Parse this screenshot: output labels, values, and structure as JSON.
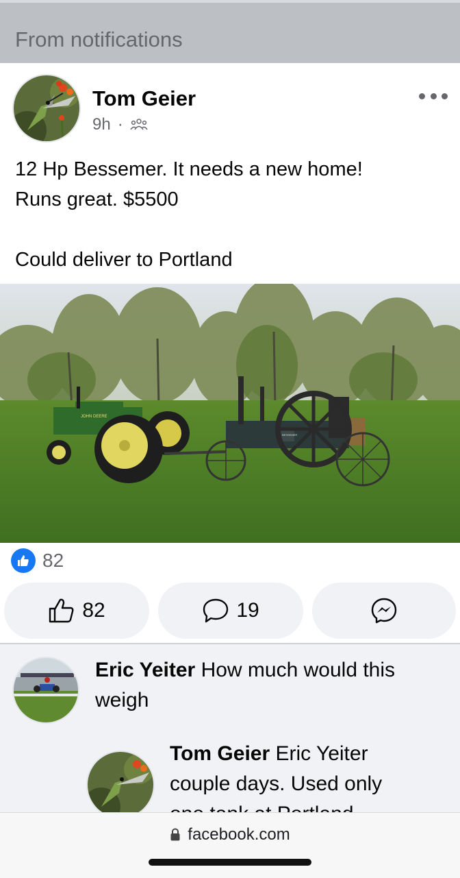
{
  "notification_bar": {
    "label": "From notifications"
  },
  "post": {
    "author": "Tom Geier",
    "time": "9h",
    "audience_icon": "friends-icon",
    "lines": [
      "12 Hp Bessemer.  It needs a new home!",
      "Runs great.  $5500",
      "",
      "Could deliver to Portland"
    ],
    "photo": {
      "tractor_label": "JOHN DEERE",
      "engine_label": "BESSEMER"
    },
    "reaction_count": "82",
    "actions": {
      "like_count": "82",
      "comment_count": "19"
    }
  },
  "comments": [
    {
      "author": "Eric Yeiter",
      "text_line1": " How much would this",
      "text_line2": "weigh"
    },
    {
      "author": "Tom Geier",
      "text_line1": " Eric Yeiter",
      "text_line2": "couple days.  Used only",
      "text_line3": "one tank at Portland"
    }
  ],
  "browser": {
    "url": "facebook.com"
  },
  "colors": {
    "accent": "#1877f2",
    "notification_bg": "#bcc0c4",
    "comment_bg": "#f0f2f5"
  }
}
